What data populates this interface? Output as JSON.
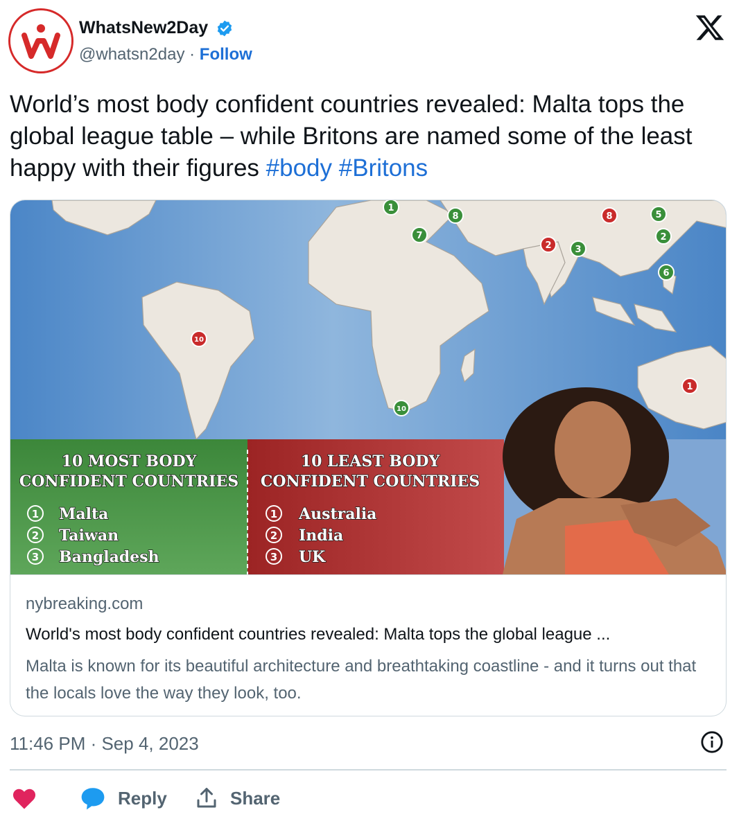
{
  "author": {
    "name": "WhatsNew2Day",
    "handle": "@whatsn2day",
    "separator": "·",
    "follow_label": "Follow"
  },
  "tweet": {
    "text": "World’s most body confident countries revealed: Malta tops the global league table – while Britons are named some of the least happy with their figures ",
    "hashtags": [
      "#body",
      "#Britons"
    ]
  },
  "card": {
    "image": {
      "most_title_line1": "10 MOST BODY",
      "most_title_line2": "CONFIDENT COUNTRIES",
      "most_items": [
        {
          "num": "1",
          "country": "Malta"
        },
        {
          "num": "2",
          "country": "Taiwan"
        },
        {
          "num": "3",
          "country": "Bangladesh"
        }
      ],
      "least_title_line1": "10 LEAST BODY",
      "least_title_line2": "CONFIDENT COUNTRIES",
      "least_items": [
        {
          "num": "1",
          "country": "Australia"
        },
        {
          "num": "2",
          "country": "India"
        },
        {
          "num": "3",
          "country": "UK"
        }
      ],
      "map_markers_green": [
        "1",
        "8",
        "7",
        "5",
        "2",
        "3",
        "6",
        "10"
      ],
      "map_markers_red": [
        "8",
        "2",
        "10",
        "1"
      ]
    },
    "domain": "nybreaking.com",
    "title": "World's most body confident countries revealed: Malta tops the global league ...",
    "description": "Malta is known for its beautiful architecture and breathtaking coastline - and it turns out that the locals love the way they look, too."
  },
  "timestamp": "11:46 PM · Sep 4, 2023",
  "actions": {
    "reply_label": "Reply",
    "share_label": "Share"
  },
  "colors": {
    "accent": "#1d6fd6",
    "like": "#e0245e",
    "reply_icon": "#1d9bf0",
    "most_panel": "#3e8a3e",
    "least_panel": "#a82b2b",
    "map_ocean": "#5b8fc9",
    "map_land": "#ece7df"
  }
}
